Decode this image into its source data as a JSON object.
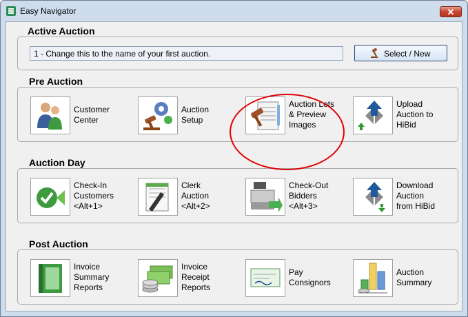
{
  "window": {
    "title": "Easy Navigator",
    "close_label": "✕"
  },
  "active_auction": {
    "heading": "Active Auction",
    "field_value": "1 - Change this to the name of your first auction.",
    "select_button": "Select / New"
  },
  "pre_auction": {
    "heading": "Pre Auction",
    "customer_center": "Customer\nCenter",
    "auction_setup": "Auction\nSetup",
    "auction_lots": "Auction Lots\n& Preview\nImages",
    "upload": "Upload\nAuction to\nHiBid"
  },
  "auction_day": {
    "heading": "Auction Day",
    "check_in": "Check-In\nCustomers\n<Alt+1>",
    "clerk": "Clerk\nAuction\n<Alt+2>",
    "check_out": "Check-Out\nBidders\n<Alt+3>",
    "download": "Download\nAuction\nfrom HiBid"
  },
  "post_auction": {
    "heading": "Post Auction",
    "invoice_summary": "Invoice\nSummary\nReports",
    "invoice_receipt": "Invoice\nReceipt\nReports",
    "pay_consignors": "Pay\nConsignors",
    "auction_summary": "Auction\nSummary"
  },
  "colors": {
    "highlight": "#e00000",
    "title_bar": "#cfdcec"
  }
}
